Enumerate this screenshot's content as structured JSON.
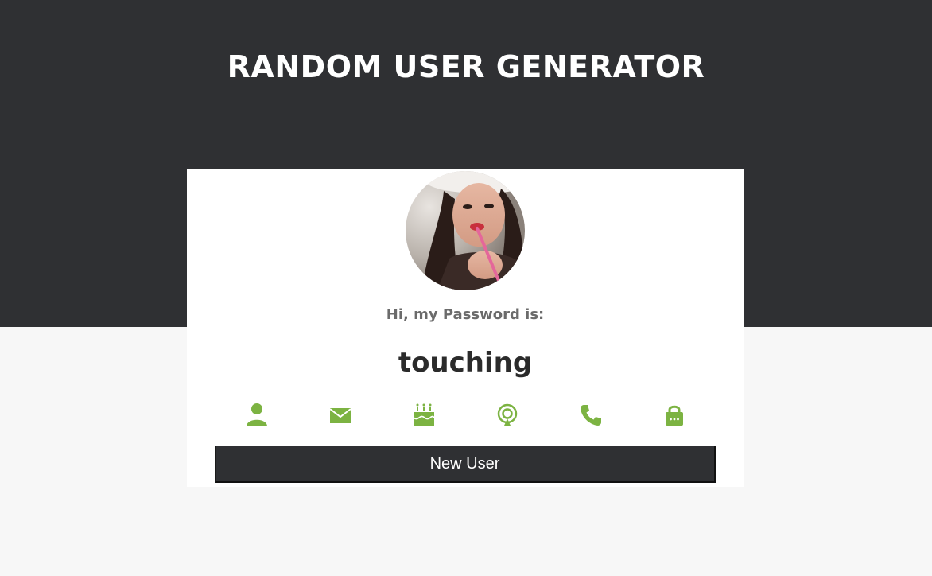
{
  "header": {
    "title": "RANDOM USER GENERATOR"
  },
  "card": {
    "avatar_alt": "user-photo",
    "label_title": "Hi, my Password is:",
    "label_value": "touching",
    "icons": [
      {
        "name": "person-icon",
        "active": false
      },
      {
        "name": "envelope-icon",
        "active": false
      },
      {
        "name": "birthday-cake-icon",
        "active": false
      },
      {
        "name": "location-pin-icon",
        "active": false
      },
      {
        "name": "phone-icon",
        "active": false
      },
      {
        "name": "lock-icon",
        "active": true
      }
    ],
    "button_label": "New User"
  },
  "colors": {
    "header_bg": "#2f3033",
    "page_bg": "#f7f7f7",
    "accent": "#7cb342",
    "button_bg": "#2f3033"
  }
}
